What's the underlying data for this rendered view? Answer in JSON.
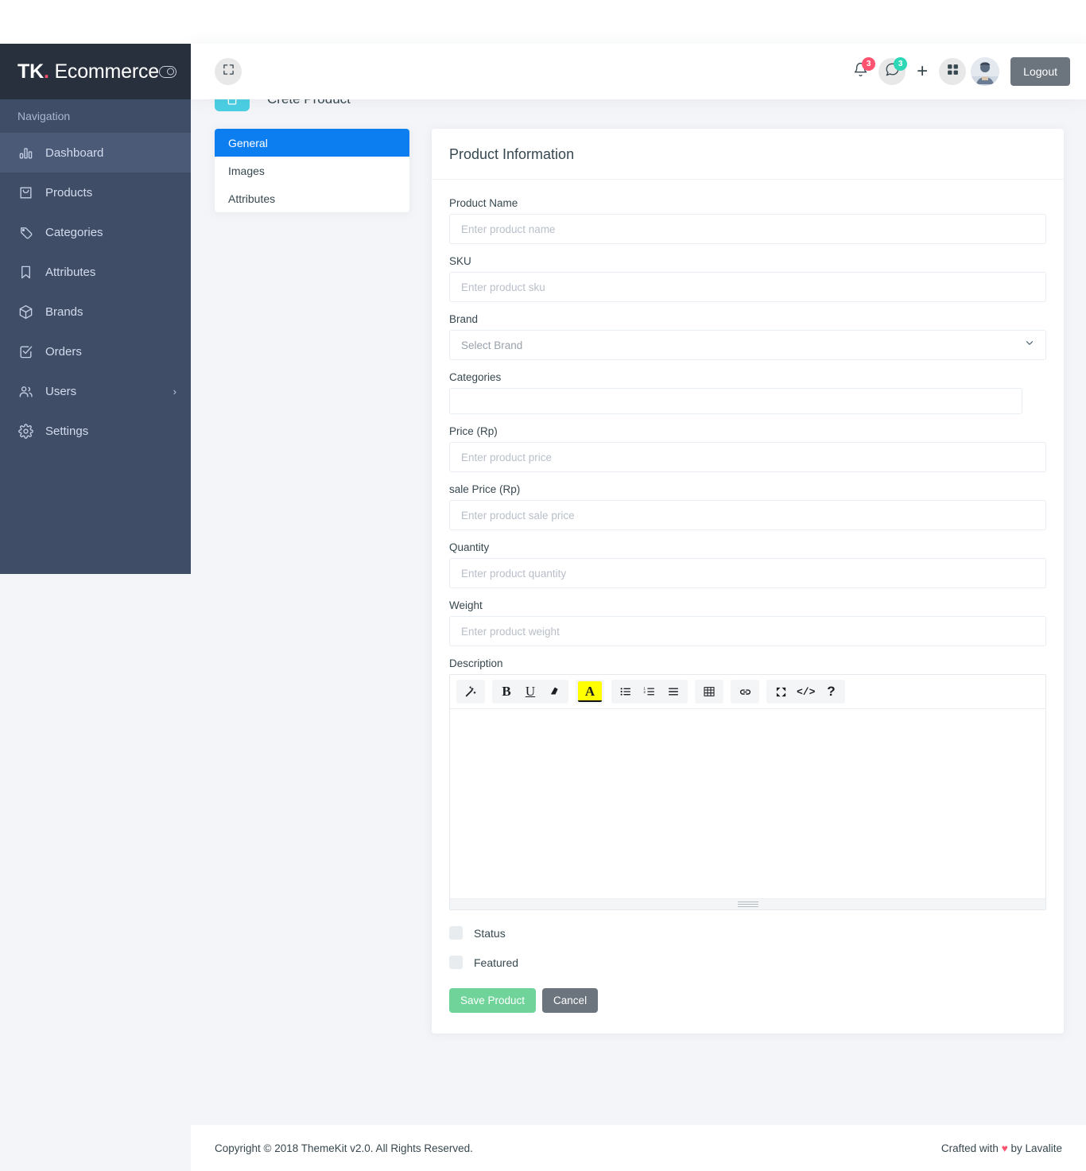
{
  "brand": {
    "mark": "TK",
    "dot": ".",
    "name": "Ecommerce"
  },
  "sidebar": {
    "caption": "Navigation",
    "items": [
      {
        "label": "Dashboard",
        "icon": "bar-chart-icon",
        "active": true,
        "arrow": ""
      },
      {
        "label": "Products",
        "icon": "shopping-bag-icon",
        "active": false,
        "arrow": ""
      },
      {
        "label": "Categories",
        "icon": "tag-icon",
        "active": false,
        "arrow": ""
      },
      {
        "label": "Attributes",
        "icon": "bookmark-icon",
        "active": false,
        "arrow": ""
      },
      {
        "label": "Brands",
        "icon": "box-icon",
        "active": false,
        "arrow": ""
      },
      {
        "label": "Orders",
        "icon": "check-square-icon",
        "active": false,
        "arrow": ""
      },
      {
        "label": "Users",
        "icon": "users-icon",
        "active": false,
        "arrow": "›"
      },
      {
        "label": "Settings",
        "icon": "gear-icon",
        "active": false,
        "arrow": ""
      }
    ]
  },
  "header": {
    "fullscreen_icon": "fullscreen-icon",
    "bell_icon": "bell-icon",
    "bell_badge": "3",
    "chat_icon": "chat-icon",
    "chat_badge": "3",
    "plus_icon": "+",
    "grid_icon": "grid-icon",
    "avatar_alt": "user-avatar",
    "logout_label": "Logout",
    "badge_red": "#ff5370",
    "badge_green": "#2ed8b6"
  },
  "page_head": {
    "icon": "clipboard-icon",
    "title": "Crete Product",
    "icon_color": "#4ccfe3"
  },
  "tabs": {
    "items": [
      {
        "label": "General",
        "active": true
      },
      {
        "label": "Images",
        "active": false
      },
      {
        "label": "Attributes",
        "active": false
      }
    ],
    "active_color": "#0d7ef0"
  },
  "form": {
    "card_title": "Product Information",
    "fields": {
      "product_name": {
        "label": "Product Name",
        "placeholder": "Enter product name",
        "value": ""
      },
      "sku": {
        "label": "SKU",
        "placeholder": "Enter product sku",
        "value": ""
      },
      "brand": {
        "label": "Brand",
        "selected": "Select Brand"
      },
      "categories": {
        "label": "Categories",
        "placeholder": "",
        "value": ""
      },
      "price": {
        "label": "Price (Rp)",
        "placeholder": "Enter product price",
        "value": ""
      },
      "sale_price": {
        "label": "sale Price (Rp)",
        "placeholder": "Enter product sale price",
        "value": ""
      },
      "quantity": {
        "label": "Quantity",
        "placeholder": "Enter product quantity",
        "value": ""
      },
      "weight": {
        "label": "Weight",
        "placeholder": "Enter product weight",
        "value": ""
      },
      "description": {
        "label": "Description",
        "value": ""
      }
    },
    "editor_toolbar": [
      {
        "name": "magic-wand-icon",
        "glyph": ""
      },
      {
        "name": "bold-icon",
        "glyph": "B"
      },
      {
        "name": "underline-icon",
        "glyph": "U"
      },
      {
        "name": "eraser-icon",
        "glyph": ""
      },
      {
        "name": "text-color-icon",
        "glyph": "A"
      },
      {
        "name": "unordered-list-icon",
        "glyph": ""
      },
      {
        "name": "ordered-list-icon",
        "glyph": ""
      },
      {
        "name": "align-icon",
        "glyph": ""
      },
      {
        "name": "table-icon",
        "glyph": ""
      },
      {
        "name": "link-icon",
        "glyph": ""
      },
      {
        "name": "fullscreen-icon",
        "glyph": ""
      },
      {
        "name": "code-view-icon",
        "glyph": "</>"
      },
      {
        "name": "help-icon",
        "glyph": "?"
      }
    ],
    "checkboxes": [
      {
        "label": "Status",
        "checked": false
      },
      {
        "label": "Featured",
        "checked": false
      }
    ],
    "save_label": "Save Product",
    "cancel_label": "Cancel",
    "save_color": "#6fd39a",
    "cancel_color": "#6c757d"
  },
  "footer": {
    "copyright": "Copyright © 2018 ThemeKit v2.0. All Rights Reserved.",
    "crafted_prefix": "Crafted with ",
    "heart": "♥",
    "crafted_suffix": " by Lavalite"
  }
}
